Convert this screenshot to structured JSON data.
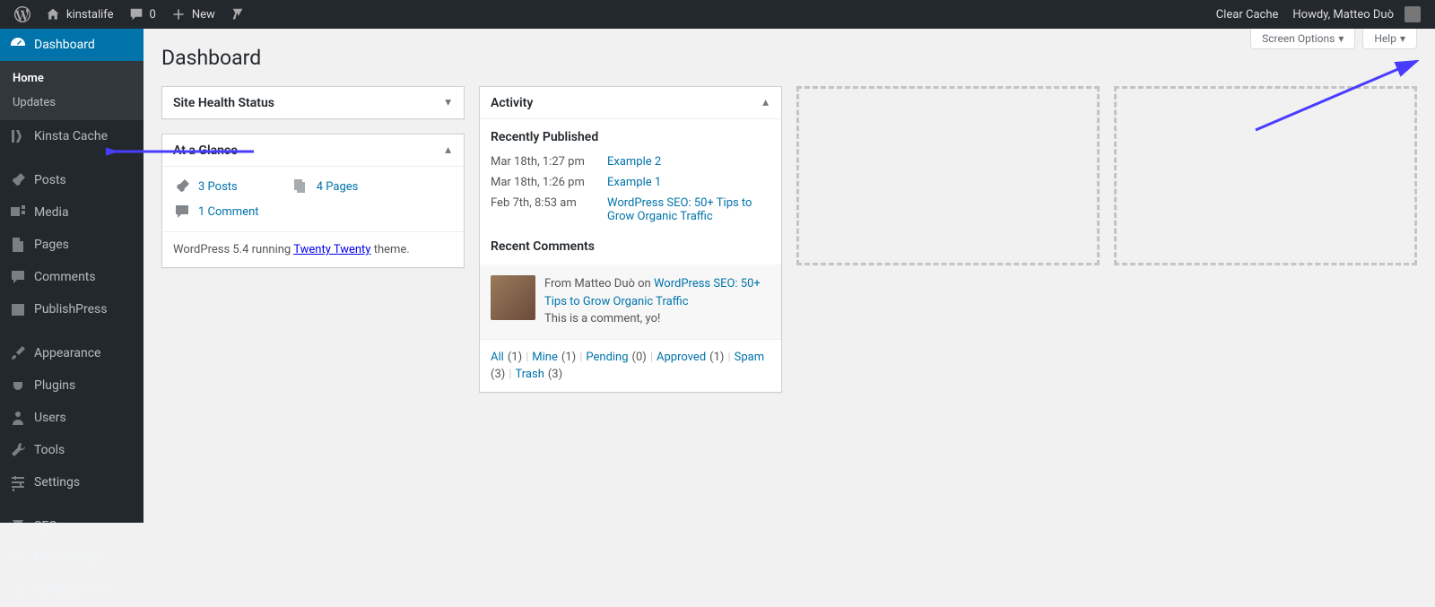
{
  "adminbar": {
    "site_name": "kinstalife",
    "comment_count": "0",
    "new_label": "New",
    "clear_cache": "Clear Cache",
    "howdy": "Howdy, Matteo Duò"
  },
  "sidebar": {
    "dashboard": "Dashboard",
    "home": "Home",
    "updates": "Updates",
    "kinsta_cache": "Kinsta Cache",
    "posts": "Posts",
    "media": "Media",
    "pages": "Pages",
    "comments": "Comments",
    "publishpress": "PublishPress",
    "appearance": "Appearance",
    "plugins": "Plugins",
    "users": "Users",
    "tools": "Tools",
    "settings": "Settings",
    "seo": "SEO",
    "menu_image": "Menu Image",
    "collapse": "Collapse menu"
  },
  "screen_meta": {
    "screen_options": "Screen Options",
    "help": "Help"
  },
  "page_title": "Dashboard",
  "site_health": {
    "title": "Site Health Status"
  },
  "glance": {
    "title": "At a Glance",
    "posts": "3 Posts",
    "pages": "4 Pages",
    "comments": "1 Comment",
    "footer_pre": "WordPress 5.4 running ",
    "footer_theme": "Twenty Twenty",
    "footer_post": " theme."
  },
  "activity": {
    "title": "Activity",
    "recently_published": "Recently Published",
    "items": [
      {
        "when": "Mar 18th, 1:27 pm",
        "what": "Example 2"
      },
      {
        "when": "Mar 18th, 1:26 pm",
        "what": "Example 1"
      },
      {
        "when": "Feb 7th, 8:53 am",
        "what": "WordPress SEO: 50+ Tips to Grow Organic Traffic"
      }
    ],
    "recent_comments": "Recent Comments",
    "comment_from_pre": "From ",
    "comment_author": "Matteo Duò",
    "comment_on": " on ",
    "comment_post": "WordPress SEO: 50+ Tips to Grow Organic Traffic",
    "comment_text": "This is a comment, yo!",
    "filters": {
      "all": "All",
      "all_n": "(1)",
      "mine": "Mine",
      "mine_n": "(1)",
      "pending": "Pending",
      "pending_n": "(0)",
      "approved": "Approved",
      "approved_n": "(1)",
      "spam": "Spam",
      "spam_n": "(3)",
      "trash": "Trash",
      "trash_n": "(3)"
    }
  }
}
